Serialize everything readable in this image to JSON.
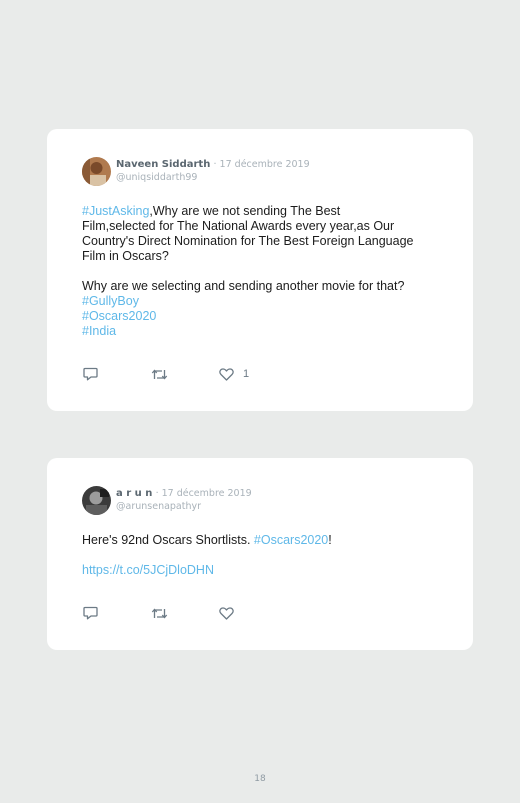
{
  "tweets": [
    {
      "author": "Naveen Siddarth",
      "date": "· 17 décembre 2019",
      "handle": "@uniqsiddarth99",
      "lines": [
        [
          {
            "t": "#JustAsking",
            "link": true
          },
          {
            "t": ",Why are we not sending The Best"
          }
        ],
        [
          {
            "t": "Film,selected for The National Awards every year,as Our"
          }
        ],
        [
          {
            "t": "Country's Direct Nomination for The Best Foreign Language"
          }
        ],
        [
          {
            "t": "Film in Oscars?"
          }
        ],
        [
          {
            "t": ""
          }
        ],
        [
          {
            "t": "Why are we selecting and sending another movie for that?"
          }
        ],
        [
          {
            "t": "#GullyBoy",
            "link": true
          }
        ],
        [
          {
            "t": "#Oscars2020",
            "link": true
          }
        ],
        [
          {
            "t": "#India",
            "link": true
          }
        ]
      ],
      "like_count": "1"
    },
    {
      "author": "a r u n",
      "date": "· 17 décembre 2019",
      "handle": "@arunsenapathyr",
      "lines": [
        [
          {
            "t": "Here's 92nd Oscars Shortlists. "
          },
          {
            "t": "#Oscars2020",
            "link": true
          },
          {
            "t": "!"
          }
        ],
        [
          {
            "t": ""
          }
        ],
        [
          {
            "t": "https://t.co/5JCjDloDHN",
            "link": true
          }
        ]
      ],
      "like_count": ""
    }
  ],
  "page_number": "18",
  "colors": {
    "background": "#e9ebea",
    "card": "#ffffff",
    "link": "#5fb8e8",
    "icon": "#6c7a85"
  },
  "icons": [
    "reply-icon",
    "retweet-icon",
    "heart-icon"
  ]
}
